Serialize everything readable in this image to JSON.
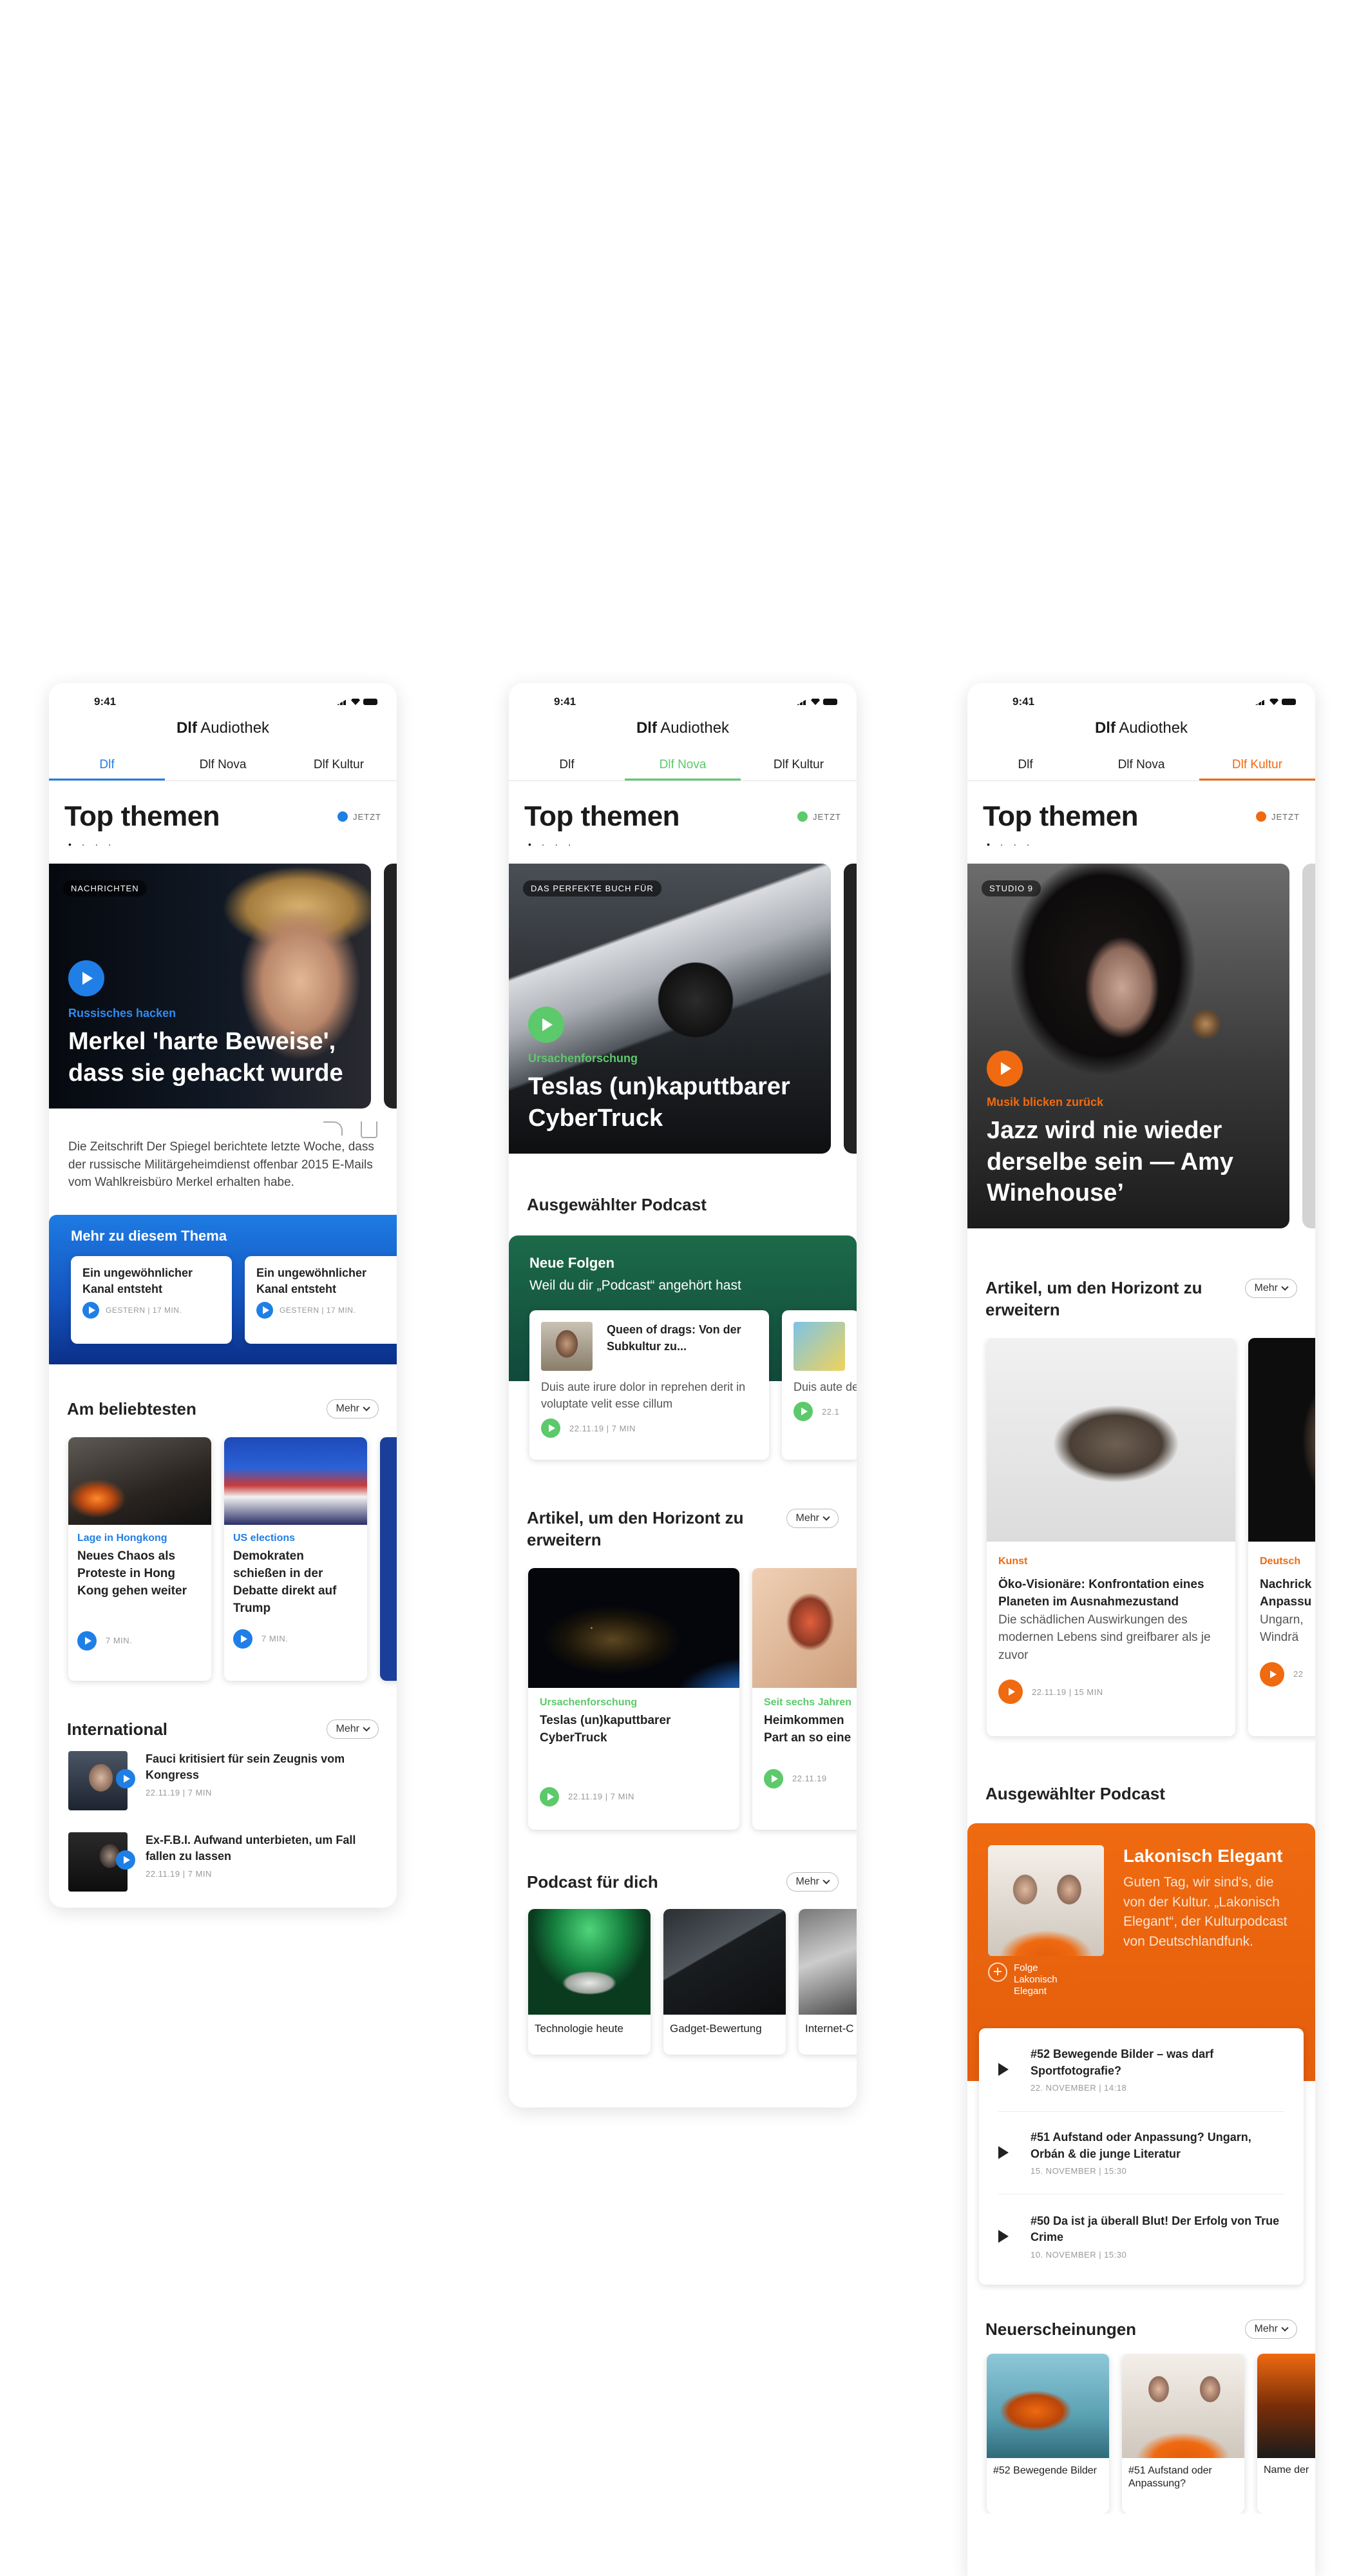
{
  "status_time": "9:41",
  "app": {
    "brand": "Dlf",
    "name": "Audiothek"
  },
  "tabs": [
    "Dlf",
    "Dlf Nova",
    "Dlf Kultur"
  ],
  "top_title": "Top themen",
  "jetzt": "JETZT",
  "dots": "• · · ·",
  "accent": {
    "dlf": "#1f7fe6",
    "nova": "#5cc96b",
    "kultur": "#ef6a10"
  },
  "phone1": {
    "hero": {
      "badge": "NACHRICHTEN",
      "kicker": "Russisches hacken",
      "title": "Merkel 'harte Beweise', dass sie gehackt wurde"
    },
    "hero_desc": "Die Zeitschrift Der Spiegel berichtete letzte Woche, dass der russische Militärgeheimdienst offenbar 2015 E-Mails vom Wahlkreisbüro Merkel erhalten habe.",
    "more_topic": {
      "title": "Mehr zu diesem Thema",
      "cards": [
        {
          "title": "Ein ungewöhnlicher Kanal entsteht",
          "meta": "GESTERN | 17 MIN."
        },
        {
          "title": "Ein ungewöhnlicher Kanal entsteht",
          "meta": "GESTERN | 17 MIN."
        }
      ]
    },
    "popular": {
      "title": "Am beliebtesten",
      "more": "Mehr",
      "cards": [
        {
          "kicker": "Lage in Hongkong",
          "title": "Neues Chaos als Proteste in Hong Kong gehen weiter",
          "meta": "7 MIN."
        },
        {
          "kicker": "US elections",
          "title": "Demokraten schießen in der Debatte direkt auf Trump",
          "meta": "7 MIN."
        }
      ]
    },
    "international": {
      "title": "International",
      "more": "Mehr",
      "items": [
        {
          "title": "Fauci kritisiert für sein Zeugnis vom Kongress",
          "meta": "22.11.19 | 7 MIN"
        },
        {
          "title": "Ex-F.B.I. Aufwand unterbieten, um Fall fallen zu lassen",
          "meta": "22.11.19 | 7 MIN"
        }
      ]
    }
  },
  "phone2": {
    "hero": {
      "badge": "DAS PERFEKTE BUCH FÜR",
      "kicker": "Ursachenforschung",
      "title": "Teslas (un)kaputtbarer CyberTruck"
    },
    "podcast_title": "Ausgewählter Podcast",
    "green_box": {
      "title": "Neue Folgen",
      "subtitle": "Weil du dir „Podcast“ angehört hast",
      "cards": [
        {
          "title": "Queen of drags: Von der Subkultur zu...",
          "desc": "Duis aute irure dolor in reprehen derit in voluptate velit esse cillum",
          "meta": "22.11.19 | 7 MIN"
        },
        {
          "title": "",
          "desc": "Duis aute derit in vo",
          "meta": "22.1"
        }
      ]
    },
    "articles": {
      "title": "Artikel, um den Horizont zu erweitern",
      "more": "Mehr",
      "cards": [
        {
          "kicker": "Ursachenforschung",
          "title": "Teslas (un)kaputtbarer CyberTruck",
          "meta": "22.11.19 | 7 MIN"
        },
        {
          "kicker": "Seit sechs Jahren",
          "title": "Heimkommen Part an so eine",
          "meta": "22.11.19"
        }
      ]
    },
    "for_you": {
      "title": "Podcast für dich",
      "more": "Mehr",
      "items": [
        "Technologie heute",
        "Gadget-Bewertung",
        "Internet-C"
      ]
    }
  },
  "phone3": {
    "hero": {
      "badge": "STUDIO 9",
      "kicker": "Musik blicken zurück",
      "title": "Jazz wird nie wieder derselbe sein  — Amy Winehouse’"
    },
    "articles": {
      "title": "Artikel, um den Horizont zu erweitern",
      "more": "Mehr",
      "cards": [
        {
          "kicker": "Kunst",
          "title": "Öko-Visionäre: Konfrontation eines Planeten im Ausnahmezustand",
          "desc": "Die schädlichen Auswirkungen des modernen Lebens sind greifbarer als je zuvor",
          "meta": "22.11.19 | 15 MIN"
        },
        {
          "kicker": "Deutsch",
          "title": "Nachrick Anpassu",
          "desc": "Ungarn, Windrä",
          "meta": "22"
        }
      ]
    },
    "podcast": {
      "title": "Ausgewählter Podcast",
      "name": "Lakonisch Elegant",
      "desc": "Guten Tag, wir sind's, die von der Kultur. „Lakonisch Elegant“, der Kulturpodcast von Deutschlandfunk.",
      "follow": "Folge Lakonisch Elegant",
      "episodes": [
        {
          "title": "#52 Bewegende Bilder – was darf Sportfotografie?",
          "meta": "22. NOVEMBER  |  14:18"
        },
        {
          "title": "#51 Aufstand oder Anpassung? Ungarn, Orbán & die junge Literatur",
          "meta": "15. NOVEMBER  |  15:30"
        },
        {
          "title": "#50 Da ist ja überall Blut! Der Erfolg von True Crime",
          "meta": "10. NOVEMBER  |  15:30"
        }
      ]
    },
    "new_releases": {
      "title": "Neuerscheinungen",
      "more": "Mehr",
      "items": [
        "#52 Bewegende Bilder",
        "#51 Aufstand oder Anpassung?",
        "Name der"
      ]
    }
  }
}
